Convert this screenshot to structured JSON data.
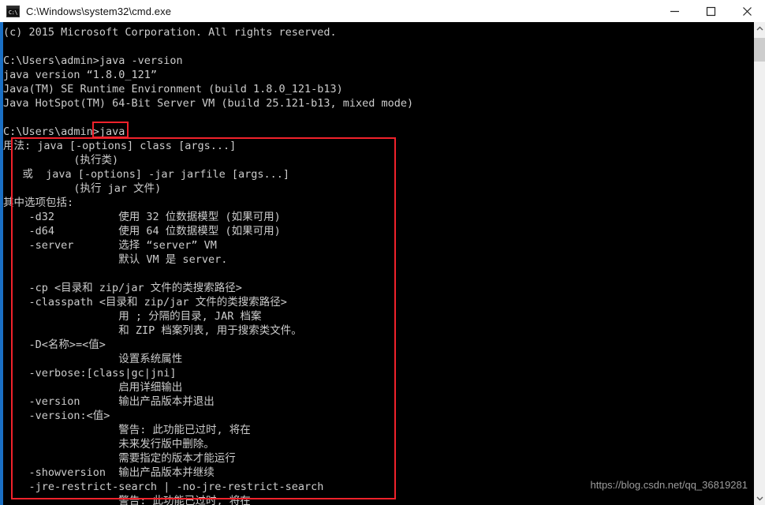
{
  "window": {
    "title": "C:\\Windows\\system32\\cmd.exe",
    "icon": "cmd-console-icon",
    "icon_glyph": "C:\\",
    "controls": {
      "minimize_label": "Minimize",
      "maximize_label": "Maximize",
      "close_label": "Close"
    }
  },
  "console": {
    "background_color": "#000000",
    "text_color": "#cccccc",
    "accent_color": "#1a6fc4",
    "lines": [
      "(c) 2015 Microsoft Corporation. All rights reserved.",
      "",
      "C:\\Users\\admin>java -version",
      "java version “1.8.0_121”",
      "Java(TM) SE Runtime Environment (build 1.8.0_121-b13)",
      "Java HotSpot(TM) 64-Bit Server VM (build 25.121-b13, mixed mode)",
      "",
      "C:\\Users\\admin>java",
      "用法: java [-options] class [args...]",
      "           (执行类)",
      "   或  java [-options] -jar jarfile [args...]",
      "           (执行 jar 文件)",
      "其中选项包括:",
      "    -d32          使用 32 位数据模型 (如果可用)",
      "    -d64          使用 64 位数据模型 (如果可用)",
      "    -server       选择 “server” VM",
      "                  默认 VM 是 server.",
      "",
      "    -cp <目录和 zip/jar 文件的类搜索路径>",
      "    -classpath <目录和 zip/jar 文件的类搜索路径>",
      "                  用 ; 分隔的目录, JAR 档案",
      "                  和 ZIP 档案列表, 用于搜索类文件。",
      "    -D<名称>=<值>",
      "                  设置系统属性",
      "    -verbose:[class|gc|jni]",
      "                  启用详细输出",
      "    -version      输出产品版本并退出",
      "    -version:<值>",
      "                  警告: 此功能已过时, 将在",
      "                  未来发行版中删除。",
      "                  需要指定的版本才能运行",
      "    -showversion  输出产品版本并继续",
      "    -jre-restrict-search | -no-jre-restrict-search",
      "                  警告: 此功能已过时, 将在"
    ]
  },
  "annotations": {
    "color": "#f0222b",
    "prompt_box_label": ">java",
    "usage_box_label": "java usage output"
  },
  "watermark": {
    "text": "https://blog.csdn.net/qq_36819281",
    "color": "#9d9d9d"
  },
  "scrollbar": {
    "up_arrow": "scroll-up-arrow-icon",
    "down_arrow": "scroll-down-arrow-icon",
    "thumb": "scroll-thumb"
  }
}
